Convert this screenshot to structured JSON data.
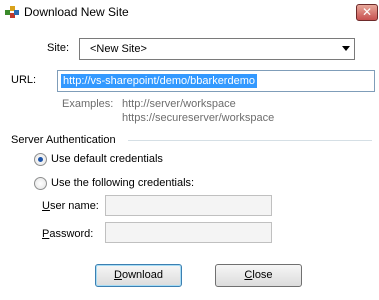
{
  "window": {
    "title": "Download New Site",
    "close_glyph": "✕"
  },
  "site": {
    "label": "Site:",
    "value": "<New Site>"
  },
  "url": {
    "label": "URL:",
    "value": "http://vs-sharepoint/demo/bbarkerdemo"
  },
  "examples": {
    "label": "Examples:",
    "line1": "http://server/workspace",
    "line2": "https://secureserver/workspace"
  },
  "auth": {
    "group_label": "Server Authentication",
    "option_default": "Use default credentials",
    "option_custom": "Use the following credentials:",
    "selected": "default",
    "username_label_mnemonic": "U",
    "username_label_rest": "ser name:",
    "username_value": "",
    "password_label_mnemonic": "P",
    "password_label_rest": "assword:",
    "password_value": ""
  },
  "buttons": {
    "download_mnemonic": "D",
    "download_rest": "ownload",
    "close_mnemonic": "C",
    "close_rest": "lose"
  },
  "colors": {
    "selection": "#3399ff",
    "close_button": "#c75050"
  }
}
